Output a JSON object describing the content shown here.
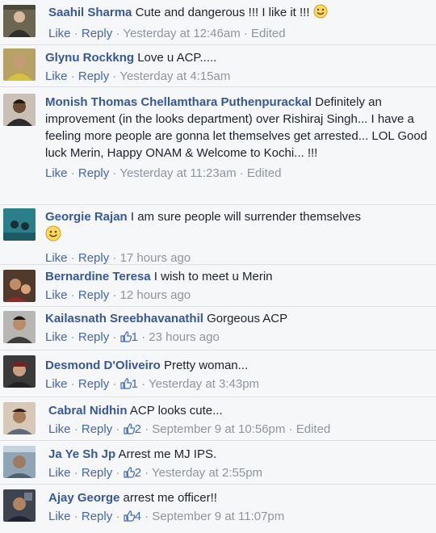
{
  "actions": {
    "like": "Like",
    "reply": "Reply",
    "sep": "·",
    "edited": "Edited"
  },
  "comments": [
    {
      "author": "Saahil Sharma",
      "text": "Cute and dangerous !!! I like it !!!",
      "emoji": "smiley-icon",
      "likes": "",
      "time": "Yesterday at 12:46am",
      "edited": true
    },
    {
      "author": "Glynu Rockkng",
      "text": "Love u ACP.....",
      "likes": "",
      "time": "Yesterday at 4:15am",
      "edited": false
    },
    {
      "author": "Monish Thomas Chellamthara Puthenpurackal",
      "text": "Definitely an improvement (in the looks department) over Rishiraj Singh... I have a feeling more people are gonna let themselves get arrested... LOL Good luck Merin, Happy ONAM & Welcome to Kochi... !!!",
      "likes": "",
      "time": "Yesterday at 11:23am",
      "edited": true
    },
    {
      "author": "Georgie Rajan",
      "text": "I am sure people will surrender themselves",
      "emoji": "smiley-icon",
      "likes": "",
      "time": "17 hours ago",
      "edited": false
    },
    {
      "author": "Bernardine Teresa",
      "text": "I wish to meet u Merin",
      "likes": "",
      "time": "12 hours ago",
      "edited": false
    },
    {
      "author": "Kailasnath Sreebhavanathil",
      "text": "Gorgeous ACP",
      "likes": "1",
      "time": "23 hours ago",
      "edited": false
    },
    {
      "author": "Desmond D'Oliveiro",
      "text": "Pretty woman...",
      "likes": "1",
      "time": "Yesterday at 3:43pm",
      "edited": false
    },
    {
      "author": "Cabral Nidhin",
      "text": "ACP looks cute...",
      "likes": "2",
      "time": "September 9 at 10:56pm",
      "edited": true
    },
    {
      "author": "Ja Ye Sh Jp",
      "text": "Arrest me MJ IPS.",
      "likes": "2",
      "time": "Yesterday at 2:55pm",
      "edited": false
    },
    {
      "author": "Ajay George",
      "text": "arrest me officer!!",
      "likes": "4",
      "time": "September 9 at 11:07pm",
      "edited": false
    }
  ],
  "colors": {
    "author": "#365899",
    "link": "#4267b2",
    "meta": "#90949c",
    "background": "#f6f7f9"
  }
}
